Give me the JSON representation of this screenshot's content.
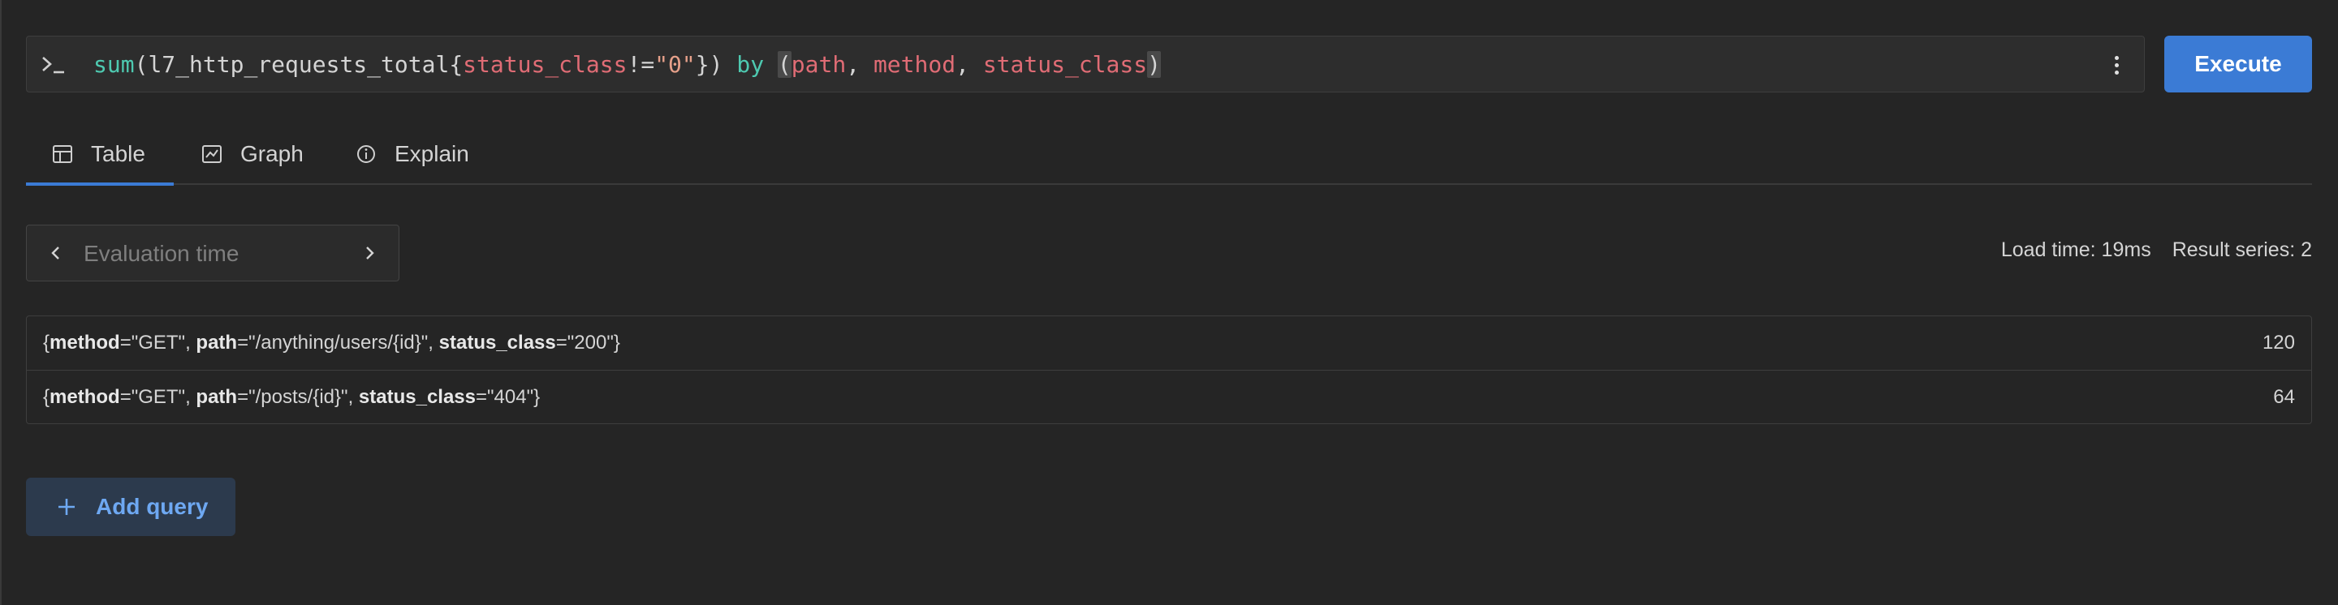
{
  "query": {
    "tokens": [
      {
        "text": "sum",
        "cls": "tk-fn"
      },
      {
        "text": "(",
        "cls": "tk-plain"
      },
      {
        "text": "l7_http_requests_total",
        "cls": "tk-plain"
      },
      {
        "text": "{",
        "cls": "tk-plain"
      },
      {
        "text": "status_class",
        "cls": "tk-lbl"
      },
      {
        "text": "!=",
        "cls": "tk-plain"
      },
      {
        "text": "\"0\"",
        "cls": "tk-str"
      },
      {
        "text": "})",
        "cls": "tk-plain"
      },
      {
        "text": " by ",
        "cls": "tk-kw"
      },
      {
        "text": "(",
        "cls": "tk-hl"
      },
      {
        "text": "path",
        "cls": "tk-lbl"
      },
      {
        "text": ", ",
        "cls": "tk-plain"
      },
      {
        "text": "method",
        "cls": "tk-lbl"
      },
      {
        "text": ", ",
        "cls": "tk-plain"
      },
      {
        "text": "status_class",
        "cls": "tk-lbl"
      },
      {
        "text": ")",
        "cls": "tk-hl"
      }
    ],
    "execute_label": "Execute"
  },
  "tabs": [
    {
      "label": "Table",
      "icon": "table-icon",
      "active": true
    },
    {
      "label": "Graph",
      "icon": "graph-icon",
      "active": false
    },
    {
      "label": "Explain",
      "icon": "info-icon",
      "active": false
    }
  ],
  "eval": {
    "placeholder": "Evaluation time"
  },
  "stats": {
    "load_time": "Load time: 19ms",
    "result_series": "Result series: 2"
  },
  "results": [
    {
      "labels": [
        {
          "key": "method",
          "value": "\"GET\""
        },
        {
          "key": "path",
          "value": "\"/anything/users/{id}\""
        },
        {
          "key": "status_class",
          "value": "\"200\""
        }
      ],
      "value": "120"
    },
    {
      "labels": [
        {
          "key": "method",
          "value": "\"GET\""
        },
        {
          "key": "path",
          "value": "\"/posts/{id}\""
        },
        {
          "key": "status_class",
          "value": "\"404\""
        }
      ],
      "value": "64"
    }
  ],
  "add_query_label": "Add query",
  "colors": {
    "accent": "#3b7bd5",
    "background": "#252525",
    "add_query_text": "#6ea8f2"
  }
}
